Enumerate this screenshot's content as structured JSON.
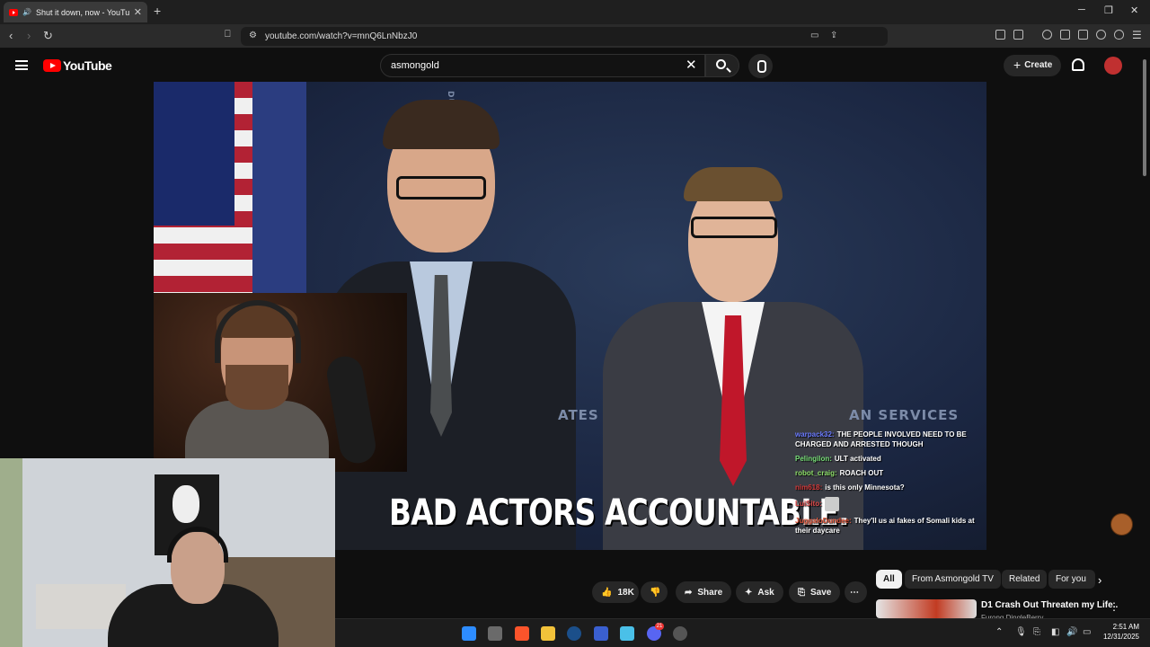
{
  "browser": {
    "tab_title": "Shut it down, now - YouTube",
    "url": "youtube.com/watch?v=mnQ6LnNbzJ0",
    "new_tab": "+",
    "window_controls": [
      "─",
      "❐",
      "✕"
    ],
    "notification_count": "1"
  },
  "youtube": {
    "logo_text": "YouTube",
    "search_query": "asmongold",
    "create_label": "Create"
  },
  "video": {
    "caption": "BAD ACTORS ACCOUNTABLE.",
    "backdrop_left": "ATES",
    "backdrop_right": "AN SERVICES",
    "backdrop_seal": "DUMA"
  },
  "chat": [
    {
      "user": "warpack32:",
      "user_color": "#6b7bff",
      "message": "THE PEOPLE INVOLVED NEED TO BE CHARGED AND ARRESTED THOUGH"
    },
    {
      "user": "Pelingilon:",
      "user_color": "#7ae07a",
      "message": "ULT activated"
    },
    {
      "user": "robot_craig:",
      "user_color": "#8fe06a",
      "message": "ROACH OUT"
    },
    {
      "user": "nim618:",
      "user_color": "#d23a3a",
      "message": "is this only Minnesota?"
    },
    {
      "user": "LuiSito:",
      "user_color": "#e04a4a",
      "message": ""
    },
    {
      "user": "JuggaloDundee:",
      "user_color": "#e0553a",
      "message": "They'll us ai fakes of Somali kids at their daycare"
    }
  ],
  "actions": {
    "likes": "18K",
    "share": "Share",
    "ask": "Ask",
    "save": "Save",
    "more": "⋯"
  },
  "chips": [
    "All",
    "From Asmongold TV",
    "Related",
    "For you"
  ],
  "recommendation": {
    "title": "D1 Crash Out Threaten my Life..",
    "channel": "Furong DingleBerry"
  },
  "taskbar": {
    "time": "2:51 AM",
    "date": "12/31/2025",
    "discord_badge": "21"
  }
}
